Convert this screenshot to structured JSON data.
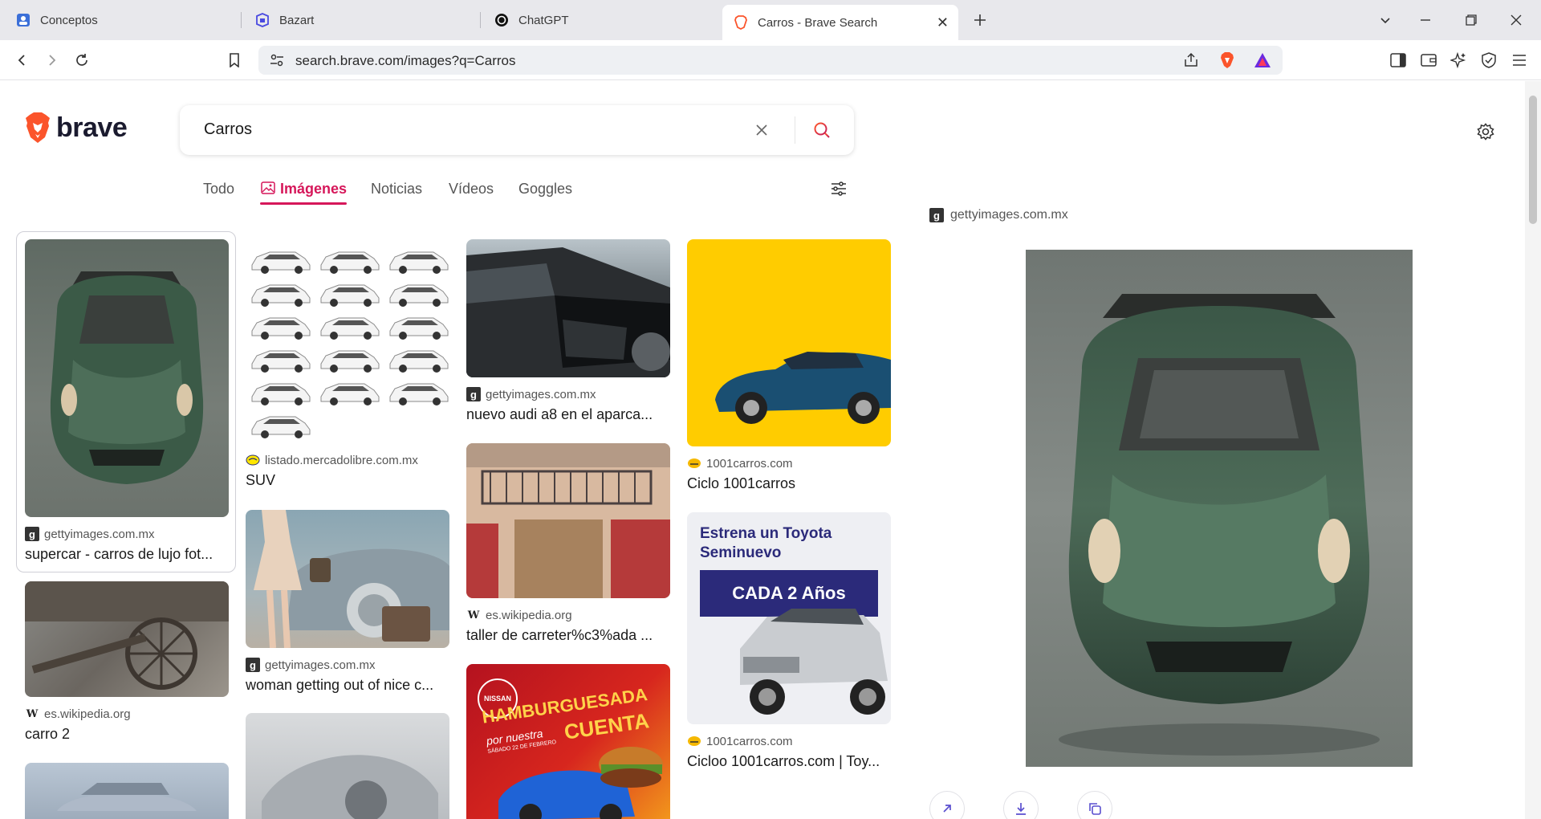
{
  "browser": {
    "tabs": [
      {
        "label": "Conceptos",
        "active": false
      },
      {
        "label": "Bazart",
        "active": false
      },
      {
        "label": "ChatGPT",
        "active": false
      },
      {
        "label": "Carros - Brave Search",
        "active": true
      }
    ],
    "url": "search.brave.com/images?q=Carros"
  },
  "page": {
    "logo_text": "brave",
    "search_query": "Carros",
    "nav_tabs": [
      {
        "label": "Todo"
      },
      {
        "label": "Imágenes"
      },
      {
        "label": "Noticias"
      },
      {
        "label": "Vídeos"
      },
      {
        "label": "Goggles"
      }
    ],
    "results": [
      {
        "source": "gettyimages.com.mx",
        "title": "supercar - carros de lujo fot..."
      },
      {
        "source": "listado.mercadolibre.com.mx",
        "title": "SUV"
      },
      {
        "source": "gettyimages.com.mx",
        "title": "nuevo audi a8 en el aparca..."
      },
      {
        "source": "1001carros.com",
        "title": "Ciclo 1001carros"
      },
      {
        "source": "es.wikipedia.org",
        "title": "carro 2"
      },
      {
        "source": "gettyimages.com.mx",
        "title": "woman getting out of nice c..."
      },
      {
        "source": "es.wikipedia.org",
        "title": "taller de carreter%c3%ada ..."
      },
      {
        "source": "1001carros.com",
        "title": "Cicloo 1001carros.com | Toy..."
      }
    ],
    "ad_toyota": {
      "line1": "Estrena un Toyota",
      "line2": "Seminuevo",
      "banner": "CADA 2 Años"
    },
    "ad_burger": {
      "brand": "NISSAN",
      "line1": "HAMBURGUESADA",
      "line2": "por nuestra",
      "line3": "CUENTA",
      "small": "SÁBADO 22 DE FEBRERO"
    },
    "preview": {
      "source": "gettyimages.com.mx"
    }
  },
  "colors": {
    "accent": "#d6175a",
    "brave_orange": "#fb542b"
  }
}
